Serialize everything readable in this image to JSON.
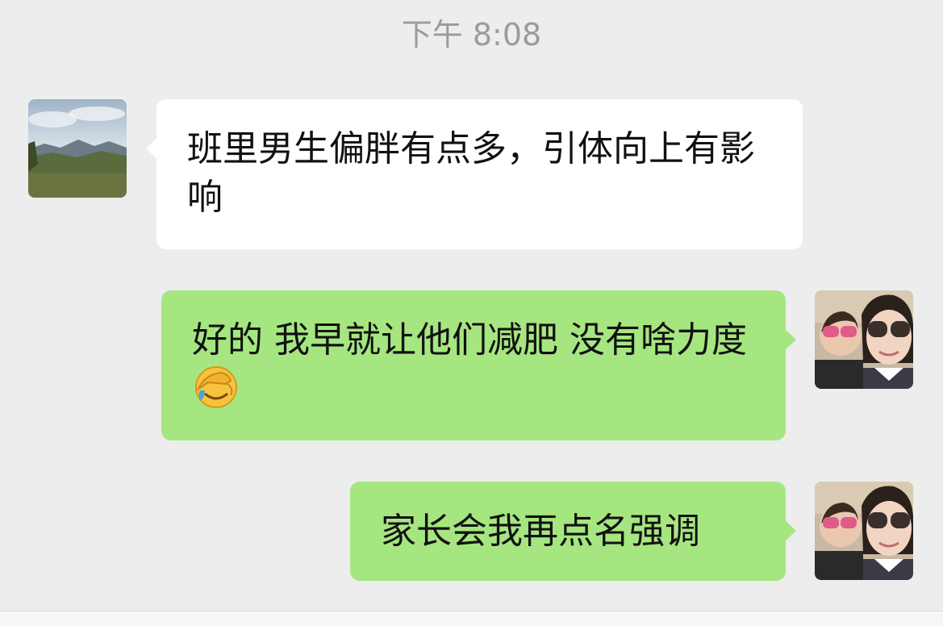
{
  "timestamp": "下午 8:08",
  "messages": [
    {
      "side": "left",
      "sender_avatar": "landscape-avatar",
      "text": "班里男生偏胖有点多，引体向上有影响"
    },
    {
      "side": "right",
      "sender_avatar": "selfie-avatar",
      "text": "好的 我早就让他们减肥 没有啥力度",
      "emoji": "face-palm-emoji"
    },
    {
      "side": "right",
      "sender_avatar": "selfie-avatar",
      "text": "家长会我再点名强调"
    }
  ],
  "colors": {
    "background": "#ededed",
    "incoming_bubble": "#ffffff",
    "outgoing_bubble": "#a6e680",
    "timestamp": "#9b9b9b"
  }
}
